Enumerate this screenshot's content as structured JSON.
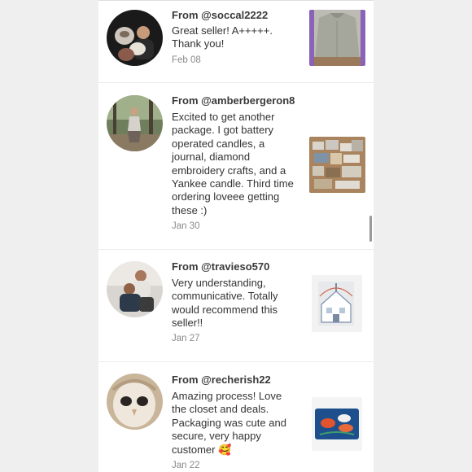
{
  "reviews": [
    {
      "from": "From @soccal2222",
      "text": "Great seller! A+++++. Thank you!",
      "date": "Feb 08",
      "avatar_icon": "couple-with-cat-avatar",
      "thumb_icon": "gray-hoodie-photo"
    },
    {
      "from": "From @amberbergeron8",
      "text": "Excited to get another package. I got battery operated candles, a journal, diamond embroidery crafts, and a Yankee candle. Third time ordering loveee getting these :)",
      "date": "Jan 30",
      "avatar_icon": "woman-in-forest-avatar",
      "thumb_icon": "box-of-packages-photo"
    },
    {
      "from": "From @travieso570",
      "text": "Very understanding, communicative. Totally would recommend this seller!!",
      "date": "Jan 27",
      "avatar_icon": "couple-selfie-avatar",
      "thumb_icon": "house-bag-photo"
    },
    {
      "from": "From @recherish22",
      "text": "Amazing process! Love the closet and deals. Packaging was cute and secure, very happy customer 🥰",
      "date": "Jan 22",
      "avatar_icon": "owl-avatar",
      "thumb_icon": "fish-pouch-photo"
    }
  ]
}
